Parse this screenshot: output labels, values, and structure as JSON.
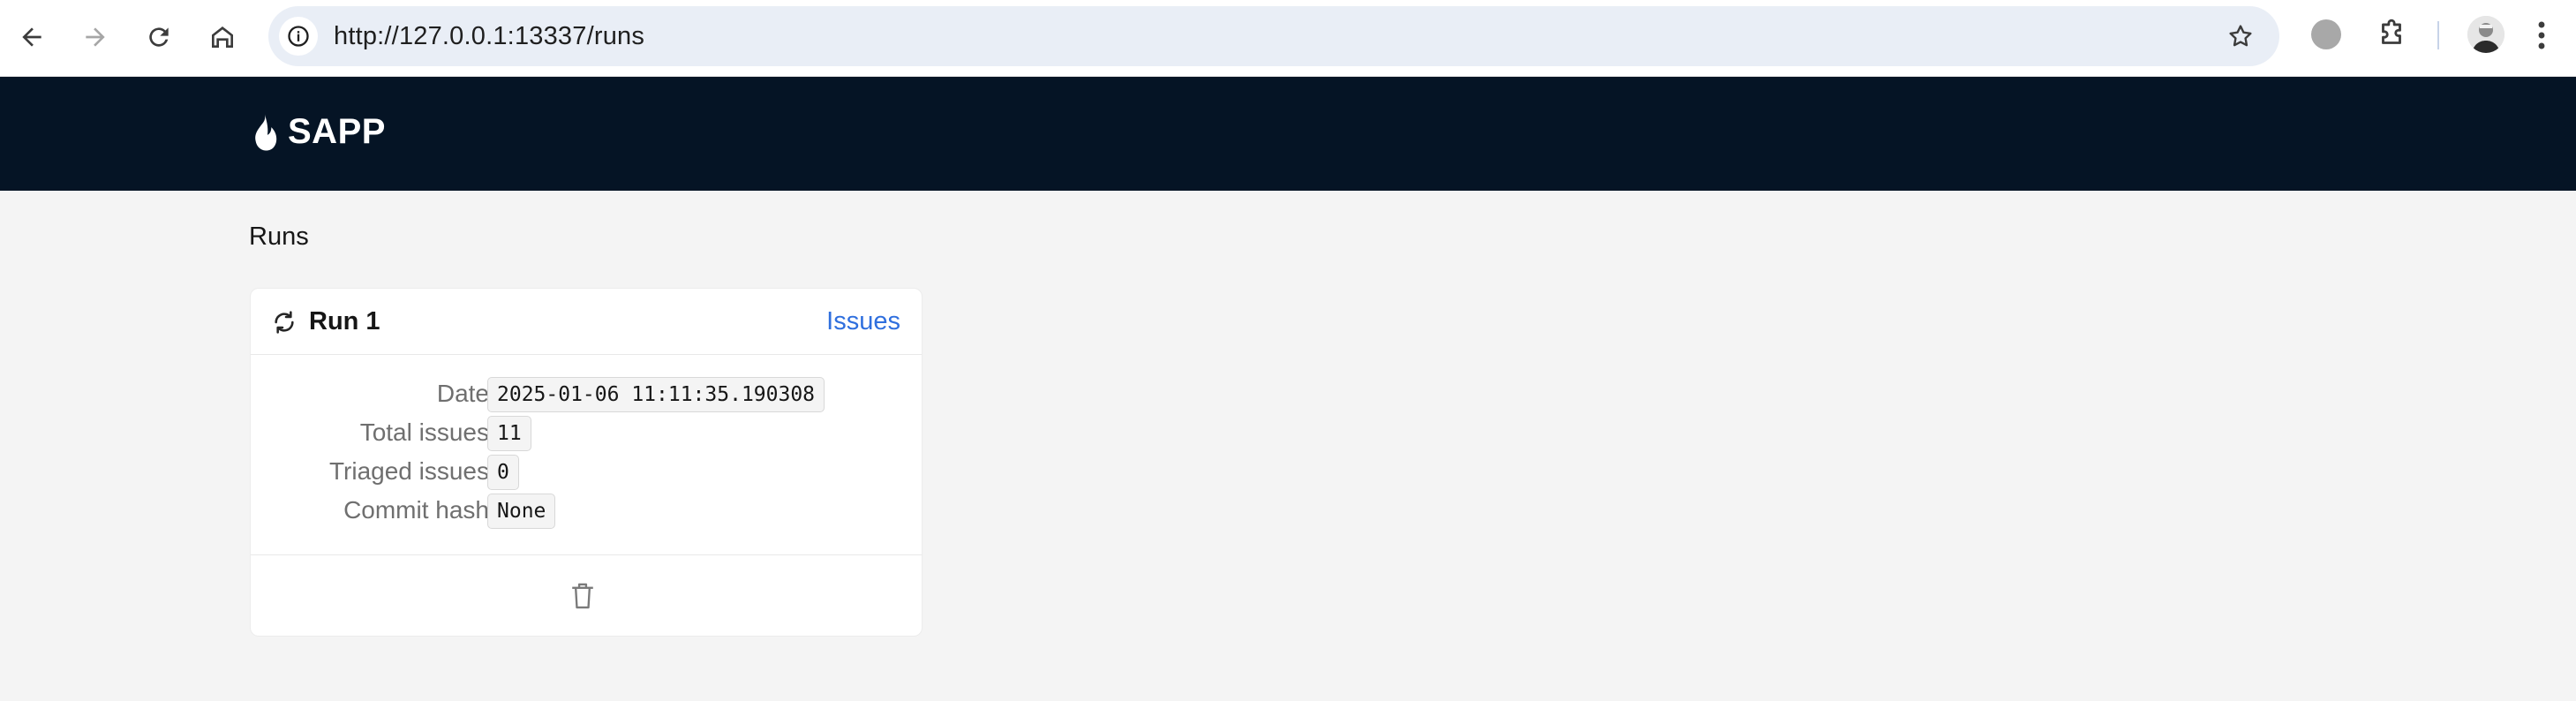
{
  "browser": {
    "url": "http://127.0.0.1:13337/runs",
    "icons": [
      "back-icon",
      "forward-icon",
      "reload-icon",
      "home-icon",
      "site-info-icon",
      "bookmark-star-icon",
      "extension-circle-icon",
      "extensions-puzzle-icon",
      "profile-avatar",
      "menu-kebab-icon"
    ]
  },
  "app": {
    "brand": "SAPP",
    "brand_color": "#051425",
    "accent_color": "#2f6fde"
  },
  "page": {
    "title": "Runs"
  },
  "run": {
    "title": "Run 1",
    "issues_link": "Issues",
    "fields": [
      {
        "label": "Date",
        "value": "2025-01-06 11:11:35.190308"
      },
      {
        "label": "Total issues",
        "value": "11"
      },
      {
        "label": "Triaged issues",
        "value": "0"
      },
      {
        "label": "Commit hash",
        "value": "None"
      }
    ]
  }
}
